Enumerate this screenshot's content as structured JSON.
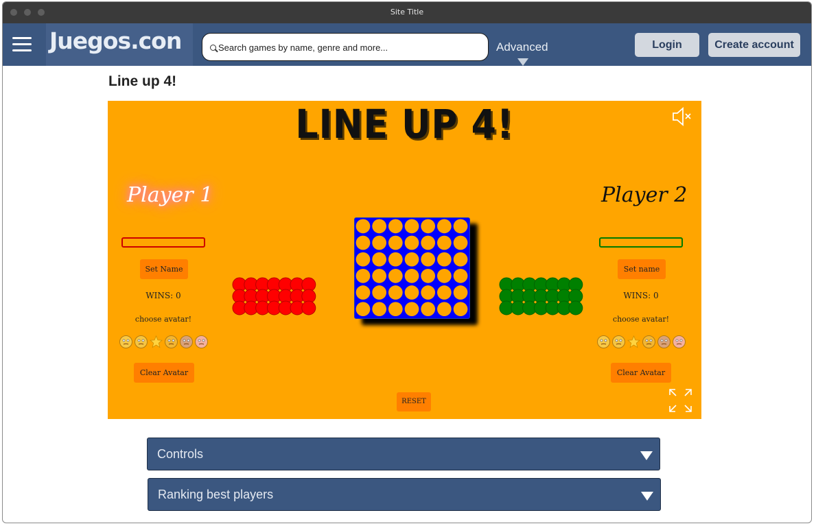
{
  "window": {
    "title": "Site Title"
  },
  "header": {
    "logo": "Juegos.con",
    "search_placeholder": "Search games by name, genre and more...",
    "advanced_label": "Advanced",
    "login_label": "Login",
    "create_account_label": "Create account"
  },
  "page": {
    "title": "Line up 4!"
  },
  "game": {
    "title": "LINE UP 4!",
    "player1": {
      "name": "Player 1",
      "set_name_label": "Set Name",
      "wins_label": "WINS: 0",
      "choose_avatar_label": "choose avatar!",
      "clear_avatar_label": "Clear Avatar",
      "field_color": "#cc0000",
      "piece_color": "#ff0000",
      "piece_border": "#b80000"
    },
    "player2": {
      "name": "Player 2",
      "set_name_label": "Set name",
      "wins_label": "WINS: 0",
      "choose_avatar_label": "choose avatar!",
      "clear_avatar_label": "Clear Avatar",
      "field_color": "#007a00",
      "piece_color": "#008000",
      "piece_border": "#006400"
    },
    "avatars": [
      "rolling-eyes-face-icon",
      "woozy-face-icon",
      "star-icon",
      "thinking-face-icon",
      "old-man-icon",
      "weary-face-icon"
    ],
    "board": {
      "rows": 6,
      "cols": 7,
      "color": "#0000ff",
      "empty_slot_color": "#ffa500"
    },
    "reset_label": "RESET",
    "background_color": "#ffa500"
  },
  "sections": [
    {
      "label": "Controls"
    },
    {
      "label": "Ranking best players"
    }
  ],
  "colors": {
    "nav": "#3b5780",
    "button": "#ff7f00"
  }
}
